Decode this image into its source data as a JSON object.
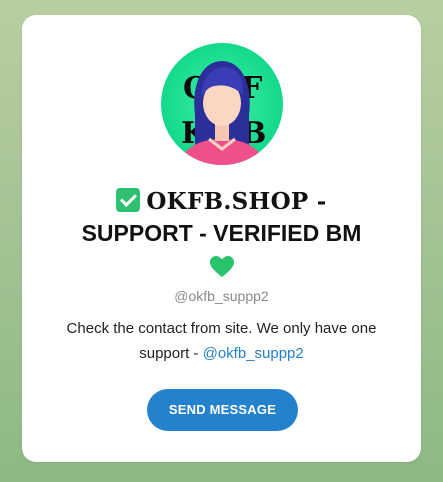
{
  "profile": {
    "avatar_icon": "okfb-avatar-woman-icon",
    "avatar_letters": [
      "O",
      "F",
      "K",
      "B"
    ],
    "verified_icon": "check-box-icon",
    "title_brand": "OKFB.SHOP -",
    "title_line2": "SUPPORT - VERIFIED BM",
    "heart_icon": "green-heart-icon",
    "username": "@okfb_suppp2",
    "description": "Check the contact from site. We only have one support - ",
    "description_link": "@okfb_suppp2",
    "button_label": "SEND MESSAGE"
  },
  "colors": {
    "accent": "#2481cc",
    "avatar_bg": "#14d98a",
    "heart": "#27c46b",
    "check": "#2fbf71"
  }
}
